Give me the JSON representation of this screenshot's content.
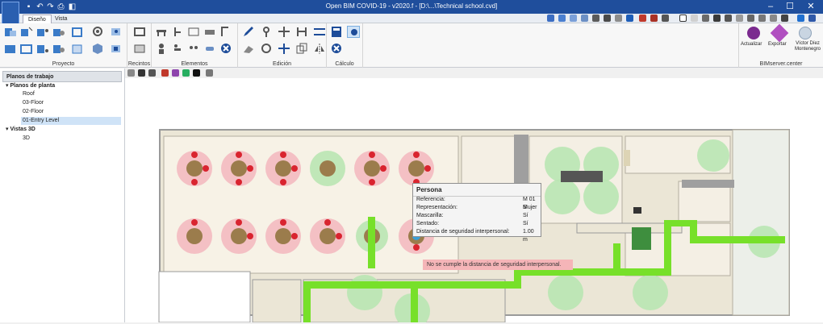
{
  "window": {
    "title": "Open BIM COVID-19 - v2020.f - [D:\\...\\Technical school.cvd]",
    "controls": [
      "–",
      "☐",
      "✕"
    ]
  },
  "tabs": [
    {
      "label": "Diseño",
      "active": true
    },
    {
      "label": "Vista",
      "active": false
    }
  ],
  "ribbon": {
    "groups": [
      {
        "label": "Proyecto"
      },
      {
        "label": "Recintos"
      },
      {
        "label": "Elementos"
      },
      {
        "label": "Edición"
      },
      {
        "label": "Cálculo"
      },
      {
        "label": "BIMserver.center"
      }
    ],
    "bim_buttons": [
      {
        "label": "Actualizar"
      },
      {
        "label": "Exportar"
      },
      {
        "label": "Víctor Díez Montenegro"
      }
    ]
  },
  "panel": {
    "title": "Planos de trabajo",
    "tree": [
      {
        "label": "Planos de planta",
        "expander": "▾",
        "level": 0,
        "selected": false
      },
      {
        "label": "Roof",
        "level": 1,
        "selected": false
      },
      {
        "label": "03-Floor",
        "level": 1,
        "selected": false
      },
      {
        "label": "02-Floor",
        "level": 1,
        "selected": false
      },
      {
        "label": "01-Entry Level",
        "level": 1,
        "selected": true
      },
      {
        "label": "Vistas 3D",
        "expander": "▾",
        "level": 0,
        "selected": false
      },
      {
        "label": "3D",
        "level": 1,
        "selected": false
      }
    ]
  },
  "tooltip": {
    "title": "Persona",
    "rows": [
      {
        "label": "Referencia:",
        "value": "M 01 S"
      },
      {
        "label": "Representación:",
        "value": "Mujer"
      },
      {
        "label": "Mascarilla:",
        "value": "Sí"
      },
      {
        "label": "Sentado:",
        "value": "Sí"
      },
      {
        "label": "Distancia de seguridad interpersonal:",
        "value": "1.00 m"
      }
    ]
  },
  "warning": "No se cumple la distancia de seguridad interpersonal.",
  "colors": {
    "titlebar": "#1f4e9c",
    "violation_zone": "#f3b7bd",
    "safe_zone": "#b9e6b2",
    "path": "#77e02a",
    "table": "#9b7c4c"
  }
}
